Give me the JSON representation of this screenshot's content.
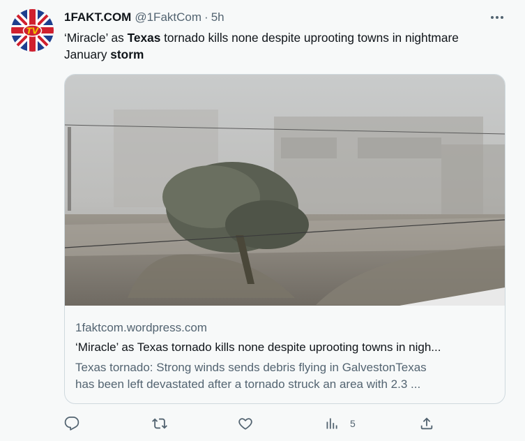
{
  "tweet": {
    "author_name": "1FAKT.COM",
    "author_handle": "@1FaktCom",
    "separator": "·",
    "timestamp": "5h",
    "avatar_text": "TV",
    "text_parts": [
      {
        "text": "‘Miracle’ as ",
        "bold": false
      },
      {
        "text": "Texas",
        "bold": true
      },
      {
        "text": " tornado kills none despite uprooting towns in nightmare January ",
        "bold": false
      },
      {
        "text": "storm",
        "bold": true
      }
    ]
  },
  "card": {
    "domain": "1faktcom.wordpress.com",
    "title": "‘Miracle’ as Texas tornado kills none despite uprooting towns in nigh...",
    "description_line1": "Texas tornado: Strong winds sends debris flying in GalvestonTexas",
    "description_line2": "has been left devastated after a tornado struck an area with 2.3 ..."
  },
  "actions": {
    "reply_icon": "reply-icon",
    "retweet_icon": "retweet-icon",
    "like_icon": "heart-icon",
    "views_icon": "views-chart-icon",
    "views_count": "5",
    "share_icon": "share-icon"
  },
  "colors": {
    "text_primary": "#0f1419",
    "text_secondary": "#536471",
    "border": "#cfd9de",
    "background": "#f7f9f9"
  }
}
